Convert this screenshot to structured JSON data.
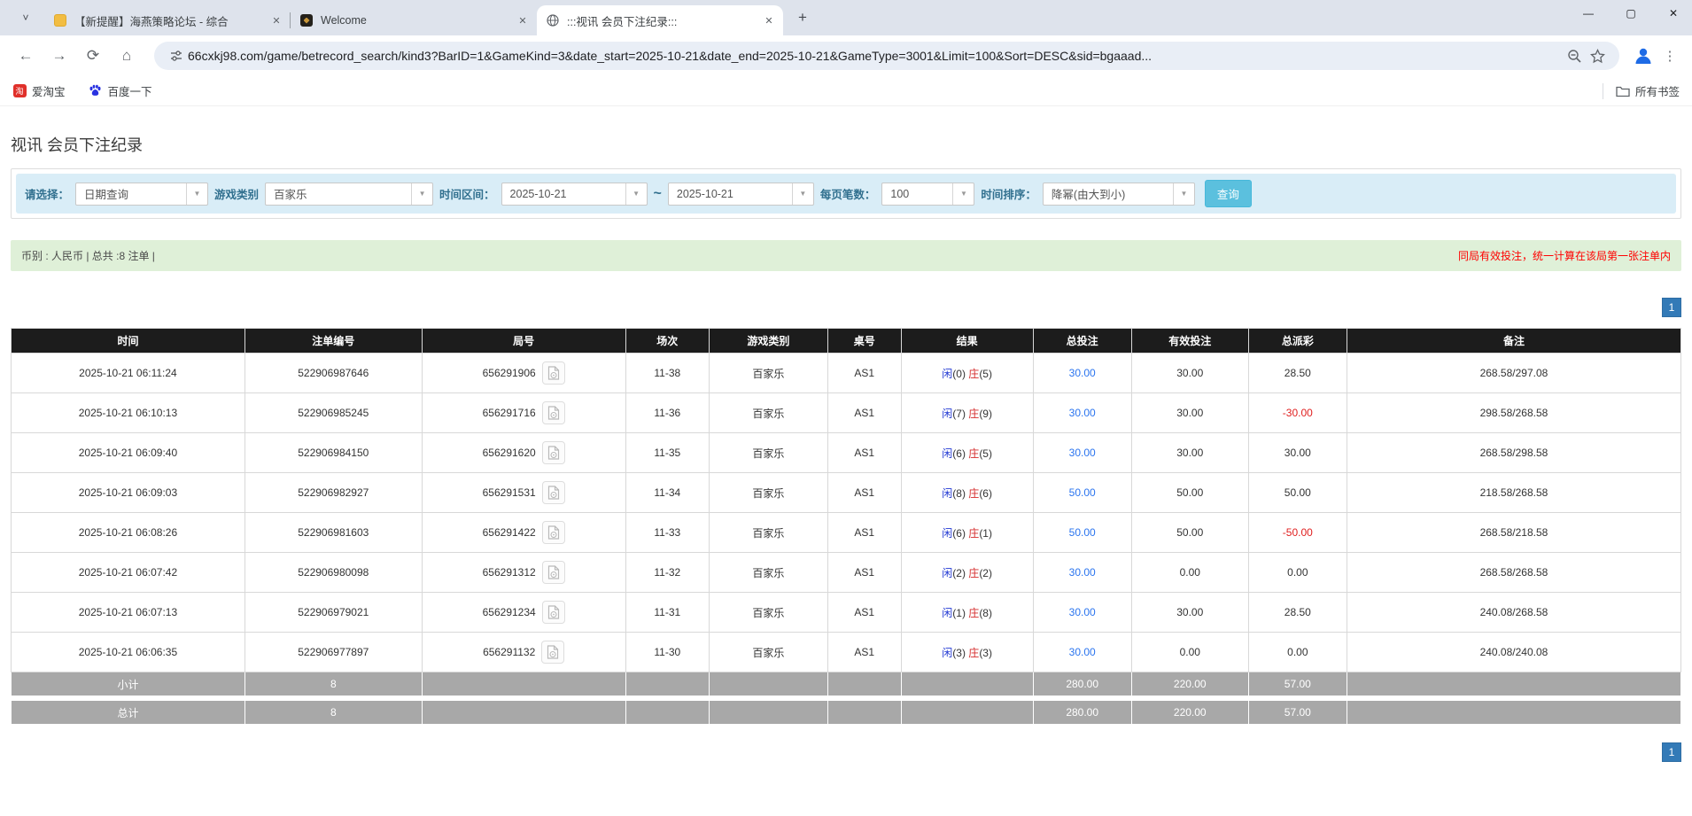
{
  "browser": {
    "tab_search_icon": "˅",
    "tabs": [
      {
        "title": "【新提醒】海燕策略论坛 - 综合",
        "close": "✕"
      },
      {
        "title": "Welcome",
        "close": "✕"
      },
      {
        "title": ":::视讯 会员下注纪录:::",
        "close": "✕"
      }
    ],
    "new_tab": "+",
    "window": {
      "minimize": "—",
      "maximize": "▢",
      "close": "✕"
    },
    "nav": {
      "back": "←",
      "forward": "→",
      "reload": "⟳",
      "home": "⌂"
    },
    "url": "66cxkj98.com/game/betrecord_search/kind3?BarID=1&GameKind=3&date_start=2025-10-21&date_end=2025-10-21&GameType=3001&Limit=100&Sort=DESC&sid=bgaaad...",
    "kebab": "⋮",
    "bookmarks": [
      {
        "label": "爱淘宝",
        "badge": "淘"
      },
      {
        "label": "百度一下"
      }
    ],
    "bookmarks_right": "所有书签"
  },
  "page": {
    "title": "视讯 会员下注纪录",
    "filters": {
      "select_label": "请选择：",
      "select_value": "日期查询",
      "game_label": "游戏类别",
      "game_value": "百家乐",
      "range_label": "时间区间：",
      "date_start": "2025-10-21",
      "tilde": "~",
      "date_end": "2025-10-21",
      "per_page_label": "每页笔数：",
      "per_page_value": "100",
      "sort_label": "时间排序：",
      "sort_value": "降幂(由大到小)",
      "search_button": "查询",
      "arrow": "▼"
    },
    "info_bar": {
      "left": "币别 : 人民币 | 总共 :8 注单 |",
      "right": "同局有效投注，统一计算在该局第一张注单内"
    },
    "pagination": "1",
    "colors": {
      "accent_button": "#5bc0de",
      "pager": "#337ab7",
      "player_blue": "#2138d3",
      "banker_red": "#d42a2a",
      "negative_red": "#e02020",
      "link_blue": "#2a74ef"
    },
    "table": {
      "headers": [
        "时间",
        "注单编号",
        "局号",
        "场次",
        "游戏类别",
        "桌号",
        "结果",
        "总投注",
        "有效投注",
        "总派彩",
        "备注"
      ],
      "rows": [
        {
          "time": "2025-10-21 06:11:24",
          "bet_id": "522906987646",
          "round": "656291906",
          "session": "11-38",
          "game": "百家乐",
          "table_no": "AS1",
          "player": "闲",
          "player_pts": "(0)",
          "banker": "庄",
          "banker_pts": "(5)",
          "total_bet": "30.00",
          "valid_bet": "30.00",
          "payout": "28.50",
          "note": "268.58/297.08"
        },
        {
          "time": "2025-10-21 06:10:13",
          "bet_id": "522906985245",
          "round": "656291716",
          "session": "11-36",
          "game": "百家乐",
          "table_no": "AS1",
          "player": "闲",
          "player_pts": "(7)",
          "banker": "庄",
          "banker_pts": "(9)",
          "total_bet": "30.00",
          "valid_bet": "30.00",
          "payout": "-30.00",
          "note": "298.58/268.58"
        },
        {
          "time": "2025-10-21 06:09:40",
          "bet_id": "522906984150",
          "round": "656291620",
          "session": "11-35",
          "game": "百家乐",
          "table_no": "AS1",
          "player": "闲",
          "player_pts": "(6)",
          "banker": "庄",
          "banker_pts": "(5)",
          "total_bet": "30.00",
          "valid_bet": "30.00",
          "payout": "30.00",
          "note": "268.58/298.58"
        },
        {
          "time": "2025-10-21 06:09:03",
          "bet_id": "522906982927",
          "round": "656291531",
          "session": "11-34",
          "game": "百家乐",
          "table_no": "AS1",
          "player": "闲",
          "player_pts": "(8)",
          "banker": "庄",
          "banker_pts": "(6)",
          "total_bet": "50.00",
          "valid_bet": "50.00",
          "payout": "50.00",
          "note": "218.58/268.58"
        },
        {
          "time": "2025-10-21 06:08:26",
          "bet_id": "522906981603",
          "round": "656291422",
          "session": "11-33",
          "game": "百家乐",
          "table_no": "AS1",
          "player": "闲",
          "player_pts": "(6)",
          "banker": "庄",
          "banker_pts": "(1)",
          "total_bet": "50.00",
          "valid_bet": "50.00",
          "payout": "-50.00",
          "note": "268.58/218.58"
        },
        {
          "time": "2025-10-21 06:07:42",
          "bet_id": "522906980098",
          "round": "656291312",
          "session": "11-32",
          "game": "百家乐",
          "table_no": "AS1",
          "player": "闲",
          "player_pts": "(2)",
          "banker": "庄",
          "banker_pts": "(2)",
          "total_bet": "30.00",
          "valid_bet": "0.00",
          "payout": "0.00",
          "note": "268.58/268.58"
        },
        {
          "time": "2025-10-21 06:07:13",
          "bet_id": "522906979021",
          "round": "656291234",
          "session": "11-31",
          "game": "百家乐",
          "table_no": "AS1",
          "player": "闲",
          "player_pts": "(1)",
          "banker": "庄",
          "banker_pts": "(8)",
          "total_bet": "30.00",
          "valid_bet": "30.00",
          "payout": "28.50",
          "note": "240.08/268.58"
        },
        {
          "time": "2025-10-21 06:06:35",
          "bet_id": "522906977897",
          "round": "656291132",
          "session": "11-30",
          "game": "百家乐",
          "table_no": "AS1",
          "player": "闲",
          "player_pts": "(3)",
          "banker": "庄",
          "banker_pts": "(3)",
          "total_bet": "30.00",
          "valid_bet": "0.00",
          "payout": "0.00",
          "note": "240.08/240.08"
        }
      ],
      "subtotal": [
        "小计",
        "8",
        "",
        "",
        "",
        "",
        "",
        "280.00",
        "220.00",
        "57.00",
        ""
      ],
      "total": [
        "总计",
        "8",
        "",
        "",
        "",
        "",
        "",
        "280.00",
        "220.00",
        "57.00",
        ""
      ]
    }
  }
}
